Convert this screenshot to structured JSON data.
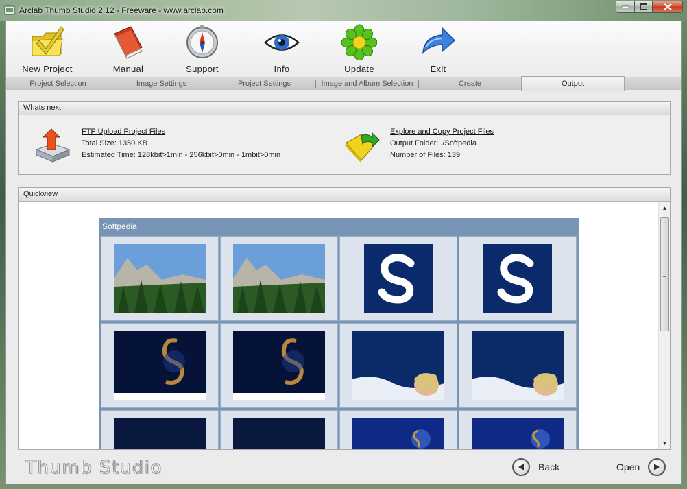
{
  "window": {
    "title": "Arclab Thumb Studio 2.12 - Freeware - www.arclab.com"
  },
  "toolbar": [
    {
      "label": "New Project",
      "icon": "new-project-checkmark-folder-icon"
    },
    {
      "label": "Manual",
      "icon": "manual-book-icon"
    },
    {
      "label": "Support",
      "icon": "support-compass-icon"
    },
    {
      "label": "Info",
      "icon": "info-eye-icon"
    },
    {
      "label": "Update",
      "icon": "update-flower-icon"
    },
    {
      "label": "Exit",
      "icon": "exit-arrow-icon"
    }
  ],
  "steps": [
    {
      "label": "Project Selection",
      "active": false
    },
    {
      "label": "Image Settings",
      "active": false
    },
    {
      "label": "Project Settings",
      "active": false
    },
    {
      "label": "Image and Album Selection",
      "active": false
    },
    {
      "label": "Create",
      "active": false
    },
    {
      "label": "Output",
      "active": true
    }
  ],
  "whats_next": {
    "heading": "Whats next",
    "ftp": {
      "link": "FTP Upload Project Files",
      "size": "Total Size: 1350 KB",
      "time": "Estimated Time: 128kbit>1min - 256kbit>0min - 1mbit>0min"
    },
    "explore": {
      "link": "Explore and Copy Project Files",
      "folder": "Output Folder: ./Softpedia",
      "count": "Number of Files: 139"
    }
  },
  "quickview": {
    "heading": "Quickview",
    "gallery_title": "Softpedia",
    "thumbnails": [
      "mountain",
      "mountain",
      "s-logo",
      "s-logo",
      "s-swirl",
      "s-swirl",
      "portrait",
      "portrait",
      "dark-banner",
      "dark-banner",
      "s-globe",
      "s-globe"
    ]
  },
  "footer": {
    "brand": "Thumb Studio",
    "back_label": "Back",
    "open_label": "Open"
  },
  "colors": {
    "gallery_bg": "#7895b6",
    "cell_bg": "#dce3ec",
    "s_logo_bg": "#0b2a6b"
  }
}
